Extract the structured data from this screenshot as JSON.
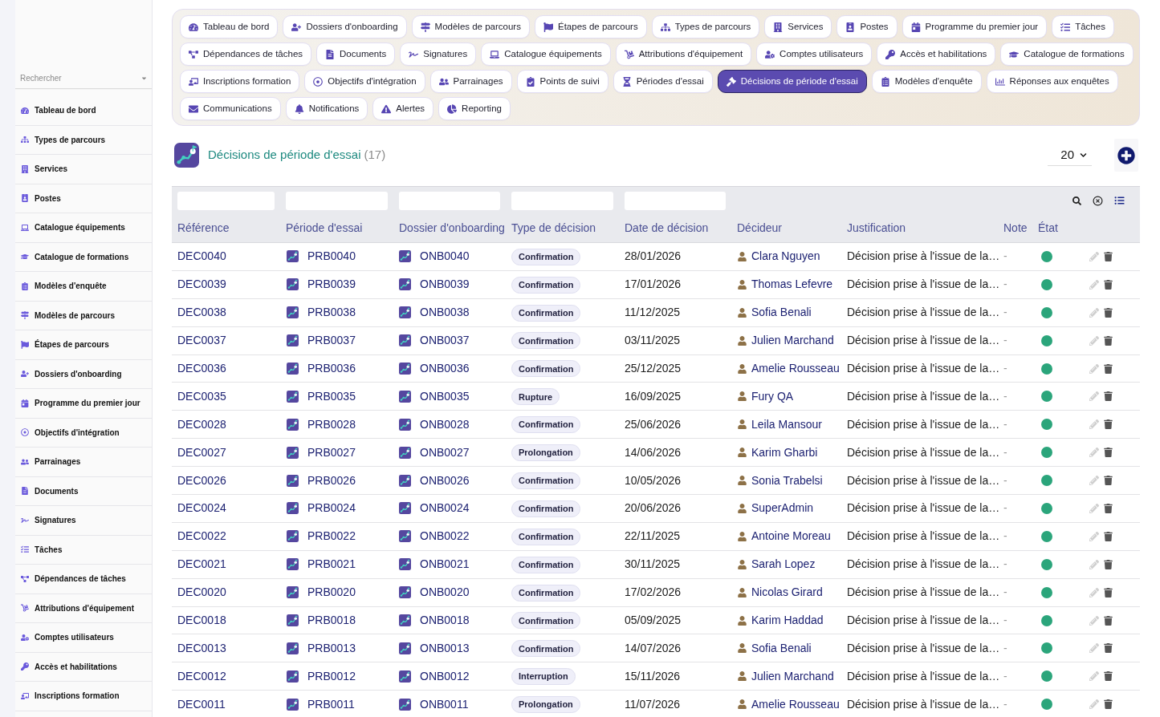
{
  "sidebar": {
    "search": {
      "placeholder": "Rechercher"
    },
    "items": [
      {
        "label": "Tableau de bord"
      },
      {
        "label": "Types de parcours"
      },
      {
        "label": "Services"
      },
      {
        "label": "Postes"
      },
      {
        "label": "Catalogue équipements"
      },
      {
        "label": "Catalogue de formations"
      },
      {
        "label": "Modèles d'enquête"
      },
      {
        "label": "Modèles de parcours"
      },
      {
        "label": "Étapes de parcours"
      },
      {
        "label": "Dossiers d'onboarding"
      },
      {
        "label": "Programme du premier jour"
      },
      {
        "label": "Objectifs d'intégration"
      },
      {
        "label": "Parrainages"
      },
      {
        "label": "Documents"
      },
      {
        "label": "Signatures"
      },
      {
        "label": "Tâches"
      },
      {
        "label": "Dépendances de tâches"
      },
      {
        "label": "Attributions d'équipement"
      },
      {
        "label": "Comptes utilisateurs"
      },
      {
        "label": "Accès et habilitations"
      },
      {
        "label": "Inscriptions formation"
      }
    ]
  },
  "nav": {
    "tabs": [
      {
        "label": "Tableau de bord",
        "selected": false
      },
      {
        "label": "Dossiers d'onboarding",
        "selected": false
      },
      {
        "label": "Modèles de parcours",
        "selected": false
      },
      {
        "label": "Étapes de parcours",
        "selected": false
      },
      {
        "label": "Types de parcours",
        "selected": false
      },
      {
        "label": "Services",
        "selected": false
      },
      {
        "label": "Postes",
        "selected": false
      },
      {
        "label": "Programme du premier jour",
        "selected": false
      },
      {
        "label": "Tâches",
        "selected": false
      },
      {
        "label": "Dépendances de tâches",
        "selected": false
      },
      {
        "label": "Documents",
        "selected": false
      },
      {
        "label": "Signatures",
        "selected": false
      },
      {
        "label": "Catalogue équipements",
        "selected": false
      },
      {
        "label": "Attributions d'équipement",
        "selected": false
      },
      {
        "label": "Comptes utilisateurs",
        "selected": false
      },
      {
        "label": "Accès et habilitations",
        "selected": false
      },
      {
        "label": "Catalogue de formations",
        "selected": false
      },
      {
        "label": "Inscriptions formation",
        "selected": false
      },
      {
        "label": "Objectifs d'intégration",
        "selected": false
      },
      {
        "label": "Parrainages",
        "selected": false
      },
      {
        "label": "Points de suivi",
        "selected": false
      },
      {
        "label": "Périodes d'essai",
        "selected": false
      },
      {
        "label": "Décisions de période d'essai",
        "selected": true
      },
      {
        "label": "Modèles d'enquête",
        "selected": false
      },
      {
        "label": "Réponses aux enquêtes",
        "selected": false
      },
      {
        "label": "Communications",
        "selected": false
      },
      {
        "label": "Notifications",
        "selected": false
      },
      {
        "label": "Alertes",
        "selected": false
      },
      {
        "label": "Reporting",
        "selected": false
      }
    ]
  },
  "page": {
    "title": "Décisions de période d'essai",
    "count": "(17)",
    "page_size": "20"
  },
  "table": {
    "columns": [
      {
        "label": "Référence",
        "filter": true
      },
      {
        "label": "Période d'essai",
        "filter": true
      },
      {
        "label": "Dossier d'onboarding",
        "filter": true
      },
      {
        "label": "Type de décision",
        "filter": true
      },
      {
        "label": "Date de décision",
        "filter": true
      },
      {
        "label": "Décideur",
        "filter": false
      },
      {
        "label": "Justification",
        "filter": false
      },
      {
        "label": "Note",
        "filter": false
      },
      {
        "label": "État",
        "filter": false
      }
    ],
    "rows": [
      {
        "reference": "DEC0040",
        "trial_period": "PRB0040",
        "onboarding": "ONB0040",
        "decision_type": "Confirmation",
        "date": "28/01/2026",
        "decider": "Clara Nguyen",
        "justification": "Décision prise à l'issue de la…",
        "note": "-",
        "color": "#2ba57b"
      },
      {
        "reference": "DEC0039",
        "trial_period": "PRB0039",
        "onboarding": "ONB0039",
        "decision_type": "Confirmation",
        "date": "17/01/2026",
        "decider": "Thomas Lefevre",
        "justification": "Décision prise à l'issue de la…",
        "note": "-",
        "color": "#2ba57b"
      },
      {
        "reference": "DEC0038",
        "trial_period": "PRB0038",
        "onboarding": "ONB0038",
        "decision_type": "Confirmation",
        "date": "11/12/2025",
        "decider": "Sofia Benali",
        "justification": "Décision prise à l'issue de la…",
        "note": "-",
        "color": "#2ba57b"
      },
      {
        "reference": "DEC0037",
        "trial_period": "PRB0037",
        "onboarding": "ONB0037",
        "decision_type": "Confirmation",
        "date": "03/11/2025",
        "decider": "Julien Marchand",
        "justification": "Décision prise à l'issue de la…",
        "note": "-",
        "color": "#2ba57b"
      },
      {
        "reference": "DEC0036",
        "trial_period": "PRB0036",
        "onboarding": "ONB0036",
        "decision_type": "Confirmation",
        "date": "25/12/2025",
        "decider": "Amelie Rousseau",
        "justification": "Décision prise à l'issue de la…",
        "note": "-",
        "color": "#2ba57b"
      },
      {
        "reference": "DEC0035",
        "trial_period": "PRB0035",
        "onboarding": "ONB0035",
        "decision_type": "Rupture",
        "date": "16/09/2025",
        "decider": "Fury QA",
        "justification": "Décision prise à l'issue de la…",
        "note": "-",
        "color": "#2ba57b"
      },
      {
        "reference": "DEC0028",
        "trial_period": "PRB0028",
        "onboarding": "ONB0028",
        "decision_type": "Confirmation",
        "date": "25/06/2026",
        "decider": "Leila Mansour",
        "justification": "Décision prise à l'issue de la…",
        "note": "-",
        "color": "#2ba57b"
      },
      {
        "reference": "DEC0027",
        "trial_period": "PRB0027",
        "onboarding": "ONB0027",
        "decision_type": "Prolongation",
        "date": "14/06/2026",
        "decider": "Karim Gharbi",
        "justification": "Décision prise à l'issue de la…",
        "note": "-",
        "color": "#2ba57b"
      },
      {
        "reference": "DEC0026",
        "trial_period": "PRB0026",
        "onboarding": "ONB0026",
        "decision_type": "Confirmation",
        "date": "10/05/2026",
        "decider": "Sonia Trabelsi",
        "justification": "Décision prise à l'issue de la…",
        "note": "-",
        "color": "#2ba57b"
      },
      {
        "reference": "DEC0024",
        "trial_period": "PRB0024",
        "onboarding": "ONB0024",
        "decision_type": "Confirmation",
        "date": "20/06/2026",
        "decider": "SuperAdmin",
        "justification": "Décision prise à l'issue de la…",
        "note": "-",
        "color": "#2ba57b"
      },
      {
        "reference": "DEC0022",
        "trial_period": "PRB0022",
        "onboarding": "ONB0022",
        "decision_type": "Confirmation",
        "date": "22/11/2025",
        "decider": "Antoine Moreau",
        "justification": "Décision prise à l'issue de la…",
        "note": "-",
        "color": "#2ba57b"
      },
      {
        "reference": "DEC0021",
        "trial_period": "PRB0021",
        "onboarding": "ONB0021",
        "decision_type": "Confirmation",
        "date": "30/11/2025",
        "decider": "Sarah Lopez",
        "justification": "Décision prise à l'issue de la…",
        "note": "-",
        "color": "#2ba57b"
      },
      {
        "reference": "DEC0020",
        "trial_period": "PRB0020",
        "onboarding": "ONB0020",
        "decision_type": "Confirmation",
        "date": "17/02/2026",
        "decider": "Nicolas Girard",
        "justification": "Décision prise à l'issue de la…",
        "note": "-",
        "color": "#2ba57b"
      },
      {
        "reference": "DEC0018",
        "trial_period": "PRB0018",
        "onboarding": "ONB0018",
        "decision_type": "Confirmation",
        "date": "05/09/2025",
        "decider": "Karim Haddad",
        "justification": "Décision prise à l'issue de la…",
        "note": "-",
        "color": "#2ba57b"
      },
      {
        "reference": "DEC0013",
        "trial_period": "PRB0013",
        "onboarding": "ONB0013",
        "decision_type": "Confirmation",
        "date": "14/07/2026",
        "decider": "Sofia Benali",
        "justification": "Décision prise à l'issue de la…",
        "note": "-",
        "color": "#2ba57b"
      },
      {
        "reference": "DEC0012",
        "trial_period": "PRB0012",
        "onboarding": "ONB0012",
        "decision_type": "Interruption",
        "date": "15/11/2026",
        "decider": "Julien Marchand",
        "justification": "Décision prise à l'issue de la…",
        "note": "-",
        "color": "#2ba57b"
      },
      {
        "reference": "DEC0011",
        "trial_period": "PRB0011",
        "onboarding": "ONB0011",
        "decision_type": "Prolongation",
        "date": "11/07/2026",
        "decider": "Amelie Rousseau",
        "justification": "Décision prise à l'issue de la…",
        "note": "-",
        "color": "#2ba57b"
      }
    ]
  }
}
